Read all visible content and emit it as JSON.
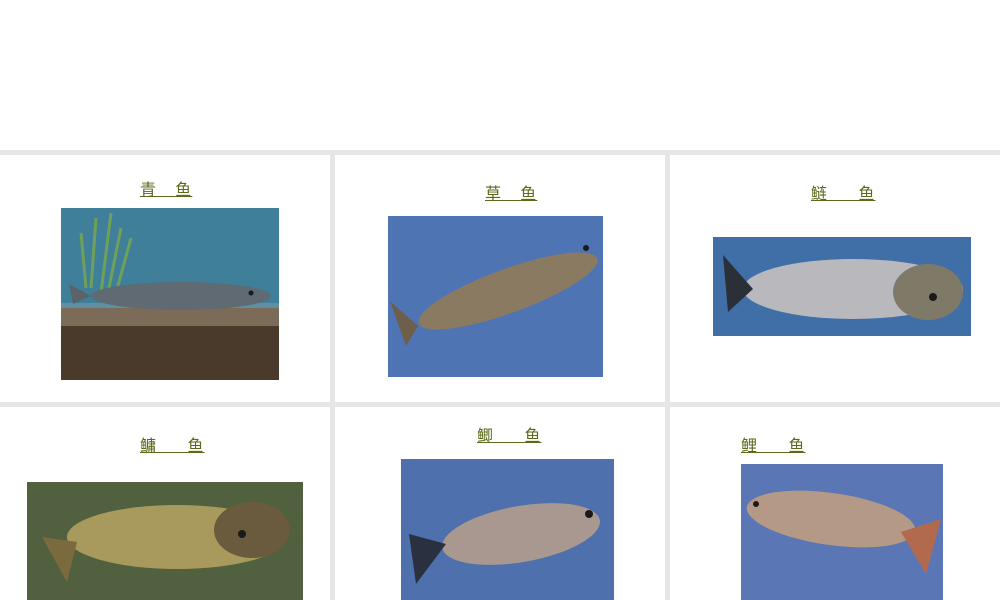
{
  "fishes": [
    {
      "name_a": "青",
      "name_b": "鱼",
      "photo": "black-carp-photo",
      "bg": "#4a7f95",
      "body": "#5f6a72"
    },
    {
      "name_a": "草",
      "name_b": "鱼",
      "photo": "grass-carp-photo",
      "bg": "#4f74b4",
      "body": "#8a7a62"
    },
    {
      "name_a": "鲢",
      "name_b": "鱼",
      "photo": "silver-carp-photo",
      "bg": "#3f6fa6",
      "body": "#b9b9bd"
    },
    {
      "name_a": "鳙",
      "name_b": "鱼",
      "photo": "bighead-carp-photo",
      "bg": "#51613f",
      "body": "#a89a5c"
    },
    {
      "name_a": "鲫",
      "name_b": "鱼",
      "photo": "crucian-carp-photo",
      "bg": "#4e70ad",
      "body": "#a89890"
    },
    {
      "name_a": "鲤",
      "name_b": "鱼",
      "photo": "common-carp-photo",
      "bg": "#5a76b4",
      "body": "#b49a86"
    }
  ]
}
